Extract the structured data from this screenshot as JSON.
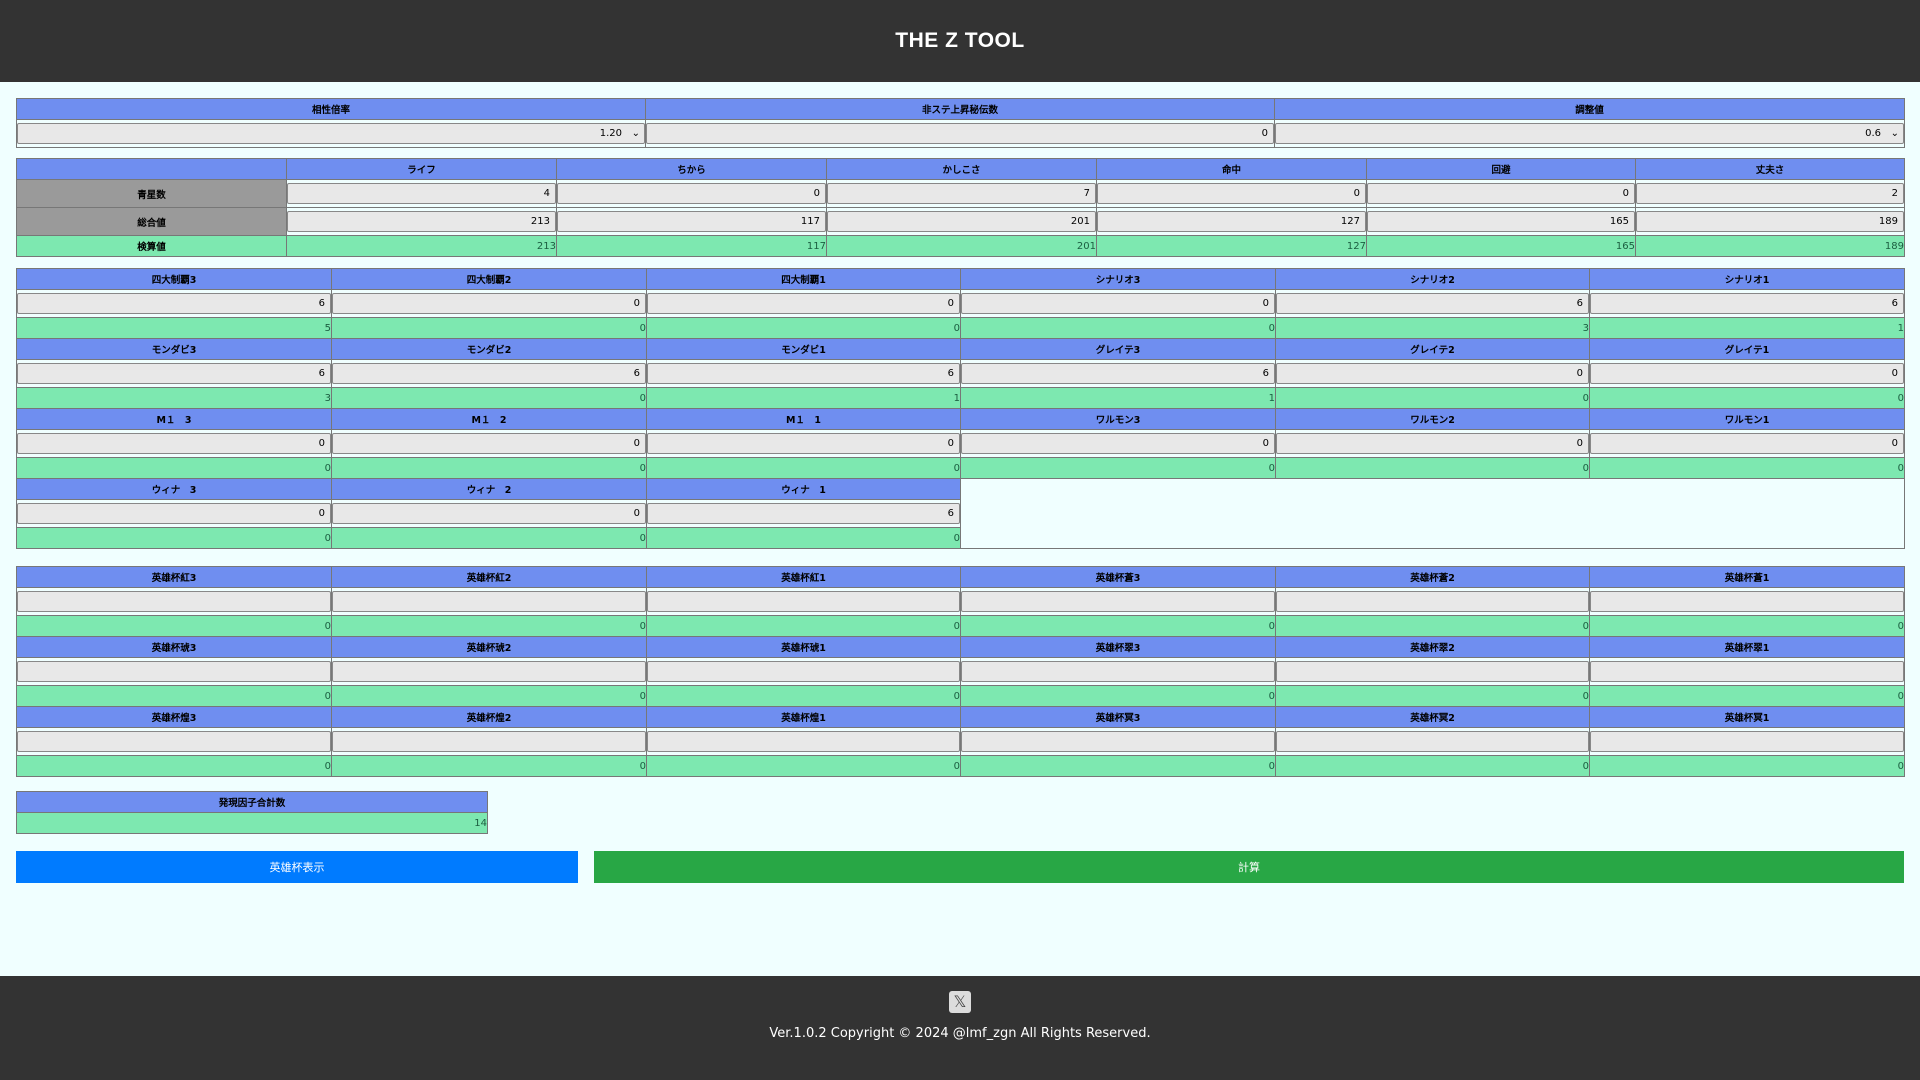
{
  "header": {
    "title": "THE Z TOOL"
  },
  "settings": {
    "columns": [
      {
        "label": "相性倍率",
        "value": "1.20",
        "type": "select"
      },
      {
        "label": "非ステ上昇秘伝数",
        "value": "0",
        "type": "input"
      },
      {
        "label": "調整値",
        "value": "0.6",
        "type": "select"
      }
    ]
  },
  "stats": {
    "columns": [
      "ライフ",
      "ちから",
      "かしこさ",
      "命中",
      "回避",
      "丈夫さ"
    ],
    "rows": [
      {
        "label": "青星数",
        "values": [
          "4",
          "0",
          "7",
          "0",
          "0",
          "2"
        ]
      },
      {
        "label": "総合値",
        "values": [
          "213",
          "117",
          "201",
          "127",
          "165",
          "189"
        ]
      }
    ],
    "result": {
      "label": "検算値",
      "values": [
        "213",
        "117",
        "201",
        "127",
        "165",
        "189"
      ]
    }
  },
  "factors": {
    "rows": [
      {
        "labels": [
          "四大制覇3",
          "四大制覇2",
          "四大制覇1",
          "シナリオ3",
          "シナリオ2",
          "シナリオ1"
        ],
        "inputs": [
          "6",
          "0",
          "0",
          "0",
          "6",
          "6"
        ],
        "results": [
          "5",
          "0",
          "0",
          "0",
          "3",
          "1"
        ]
      },
      {
        "labels": [
          "モンダビ3",
          "モンダビ2",
          "モンダビ1",
          "グレイテ3",
          "グレイテ2",
          "グレイテ1"
        ],
        "inputs": [
          "6",
          "6",
          "6",
          "6",
          "0",
          "0"
        ],
        "results": [
          "3",
          "0",
          "1",
          "1",
          "0",
          "0"
        ]
      },
      {
        "labels": [
          "M１　3",
          "M１　2",
          "M１　1",
          "ワルモン3",
          "ワルモン2",
          "ワルモン1"
        ],
        "inputs": [
          "0",
          "0",
          "0",
          "0",
          "0",
          "0"
        ],
        "results": [
          "0",
          "0",
          "0",
          "0",
          "0",
          "0"
        ]
      },
      {
        "labels": [
          "ウィナ　3",
          "ウィナ　2",
          "ウィナ　1"
        ],
        "inputs": [
          "0",
          "0",
          "6"
        ],
        "results": [
          "0",
          "0",
          "0"
        ]
      }
    ]
  },
  "hero_cups": {
    "rows": [
      {
        "labels": [
          "英雄杯紅3",
          "英雄杯紅2",
          "英雄杯紅1",
          "英雄杯蒼3",
          "英雄杯蒼2",
          "英雄杯蒼1"
        ],
        "inputs": [
          "",
          "",
          "",
          "",
          "",
          ""
        ],
        "results": [
          "0",
          "0",
          "0",
          "0",
          "0",
          "0"
        ]
      },
      {
        "labels": [
          "英雄杯琥3",
          "英雄杯琥2",
          "英雄杯琥1",
          "英雄杯翠3",
          "英雄杯翠2",
          "英雄杯翠1"
        ],
        "inputs": [
          "",
          "",
          "",
          "",
          "",
          ""
        ],
        "results": [
          "0",
          "0",
          "0",
          "0",
          "0",
          "0"
        ]
      },
      {
        "labels": [
          "英雄杯煌3",
          "英雄杯煌2",
          "英雄杯煌1",
          "英雄杯冥3",
          "英雄杯冥2",
          "英雄杯冥1"
        ],
        "inputs": [
          "",
          "",
          "",
          "",
          "",
          ""
        ],
        "results": [
          "0",
          "0",
          "0",
          "0",
          "0",
          "0"
        ]
      }
    ]
  },
  "total_factors": {
    "label": "発現因子合計数",
    "value": "14"
  },
  "buttons": {
    "show_hero_cup": "英雄杯表示",
    "calculate": "計算"
  },
  "footer": {
    "copyright": "Ver.1.0.2 Copyright © 2024 @lmf_zgn All Rights Reserved.",
    "icon": "x-logo-icon"
  },
  "colors": {
    "header_bg": "#333333",
    "page_bg": "#f0ffff",
    "col_header": "#6f8ef0",
    "result_bg": "#7de8b0",
    "label_gray": "#9a9a9a",
    "button_blue": "#007bff",
    "button_green": "#28a745"
  }
}
